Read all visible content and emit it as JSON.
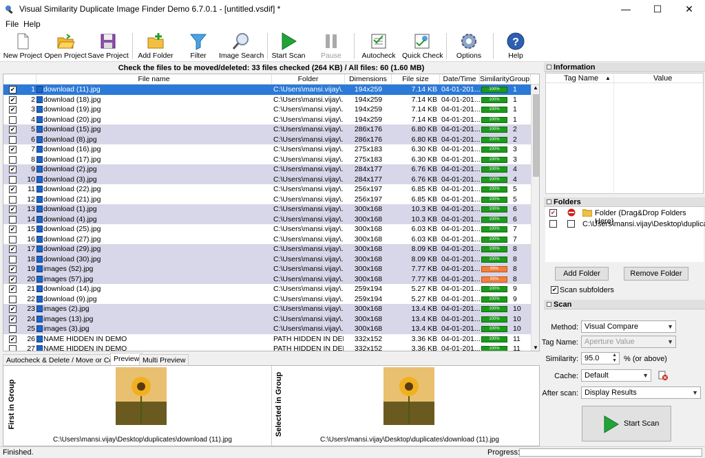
{
  "window": {
    "title": "Visual Similarity Duplicate Image Finder Demo 6.7.0.1 - [untitled.vsdif] *",
    "minimize": "—",
    "maximize": "☐",
    "close": "✕"
  },
  "menu": [
    "File",
    "Help"
  ],
  "toolbar": [
    {
      "label": "New Project",
      "icon": "new-project-icon"
    },
    {
      "label": "Open Project",
      "icon": "open-project-icon"
    },
    {
      "label": "Save Project",
      "icon": "save-project-icon"
    },
    {
      "label": "Add Folder",
      "icon": "add-folder-icon"
    },
    {
      "label": "Filter",
      "icon": "filter-icon"
    },
    {
      "label": "Image Search",
      "icon": "image-search-icon"
    },
    {
      "label": "Start Scan",
      "icon": "play-icon"
    },
    {
      "label": "Pause",
      "icon": "pause-icon"
    },
    {
      "label": "Autocheck",
      "icon": "autocheck-icon"
    },
    {
      "label": "Quick Check",
      "icon": "quick-check-icon"
    },
    {
      "label": "Options",
      "icon": "gear-icon"
    },
    {
      "label": "Help",
      "icon": "help-icon"
    }
  ],
  "results": {
    "header": "Check the files to be moved/deleted: 33 files checked (264 KB) / All files: 60 (1.60 MB)",
    "columns": [
      "File name",
      "Folder",
      "Dimensions",
      "File size",
      "Date/Time",
      "Similarity",
      "Group"
    ],
    "rows": [
      {
        "n": "1",
        "checked": true,
        "name": "download (11).jpg",
        "folder": "C:\\Users\\mansi.vijay\\...",
        "dim": "194x259",
        "size": "7.14 KB",
        "date": "04-01-201...",
        "sim": "100%",
        "group": "1"
      },
      {
        "n": "2",
        "checked": true,
        "name": "download (18).jpg",
        "folder": "C:\\Users\\mansi.vijay\\...",
        "dim": "194x259",
        "size": "7.14 KB",
        "date": "04-01-201...",
        "sim": "100%",
        "group": "1"
      },
      {
        "n": "3",
        "checked": true,
        "name": "download (19).jpg",
        "folder": "C:\\Users\\mansi.vijay\\...",
        "dim": "194x259",
        "size": "7.14 KB",
        "date": "04-01-201...",
        "sim": "100%",
        "group": "1"
      },
      {
        "n": "4",
        "checked": false,
        "name": "download (20).jpg",
        "folder": "C:\\Users\\mansi.vijay\\...",
        "dim": "194x259",
        "size": "7.14 KB",
        "date": "04-01-201...",
        "sim": "100%",
        "group": "1"
      },
      {
        "n": "5",
        "checked": true,
        "name": "download (15).jpg",
        "folder": "C:\\Users\\mansi.vijay\\...",
        "dim": "286x176",
        "size": "6.80 KB",
        "date": "04-01-201...",
        "sim": "100%",
        "group": "2"
      },
      {
        "n": "6",
        "checked": false,
        "name": "download (8).jpg",
        "folder": "C:\\Users\\mansi.vijay\\...",
        "dim": "286x176",
        "size": "6.80 KB",
        "date": "04-01-201...",
        "sim": "100%",
        "group": "2"
      },
      {
        "n": "7",
        "checked": true,
        "name": "download (16).jpg",
        "folder": "C:\\Users\\mansi.vijay\\...",
        "dim": "275x183",
        "size": "6.30 KB",
        "date": "04-01-201...",
        "sim": "100%",
        "group": "3"
      },
      {
        "n": "8",
        "checked": false,
        "name": "download (17).jpg",
        "folder": "C:\\Users\\mansi.vijay\\...",
        "dim": "275x183",
        "size": "6.30 KB",
        "date": "04-01-201...",
        "sim": "100%",
        "group": "3"
      },
      {
        "n": "9",
        "checked": true,
        "name": "download (2).jpg",
        "folder": "C:\\Users\\mansi.vijay\\...",
        "dim": "284x177",
        "size": "6.76 KB",
        "date": "04-01-201...",
        "sim": "100%",
        "group": "4"
      },
      {
        "n": "10",
        "checked": false,
        "name": "download (3).jpg",
        "folder": "C:\\Users\\mansi.vijay\\...",
        "dim": "284x177",
        "size": "6.76 KB",
        "date": "04-01-201...",
        "sim": "100%",
        "group": "4"
      },
      {
        "n": "11",
        "checked": true,
        "name": "download (22).jpg",
        "folder": "C:\\Users\\mansi.vijay\\...",
        "dim": "256x197",
        "size": "6.85 KB",
        "date": "04-01-201...",
        "sim": "100%",
        "group": "5"
      },
      {
        "n": "12",
        "checked": false,
        "name": "download (21).jpg",
        "folder": "C:\\Users\\mansi.vijay\\...",
        "dim": "256x197",
        "size": "6.85 KB",
        "date": "04-01-201...",
        "sim": "100%",
        "group": "5"
      },
      {
        "n": "13",
        "checked": true,
        "name": "download (1).jpg",
        "folder": "C:\\Users\\mansi.vijay\\...",
        "dim": "300x168",
        "size": "10.3 KB",
        "date": "04-01-201...",
        "sim": "100%",
        "group": "6"
      },
      {
        "n": "14",
        "checked": false,
        "name": "download (4).jpg",
        "folder": "C:\\Users\\mansi.vijay\\...",
        "dim": "300x168",
        "size": "10.3 KB",
        "date": "04-01-201...",
        "sim": "100%",
        "group": "6"
      },
      {
        "n": "15",
        "checked": true,
        "name": "download (25).jpg",
        "folder": "C:\\Users\\mansi.vijay\\...",
        "dim": "300x168",
        "size": "6.03 KB",
        "date": "04-01-201...",
        "sim": "100%",
        "group": "7"
      },
      {
        "n": "16",
        "checked": false,
        "name": "download (27).jpg",
        "folder": "C:\\Users\\mansi.vijay\\...",
        "dim": "300x168",
        "size": "6.03 KB",
        "date": "04-01-201...",
        "sim": "100%",
        "group": "7"
      },
      {
        "n": "17",
        "checked": true,
        "name": "download (29).jpg",
        "folder": "C:\\Users\\mansi.vijay\\...",
        "dim": "300x168",
        "size": "8.09 KB",
        "date": "04-01-201...",
        "sim": "100%",
        "group": "8"
      },
      {
        "n": "18",
        "checked": false,
        "name": "download (30).jpg",
        "folder": "C:\\Users\\mansi.vijay\\...",
        "dim": "300x168",
        "size": "8.09 KB",
        "date": "04-01-201...",
        "sim": "100%",
        "group": "8"
      },
      {
        "n": "19",
        "checked": true,
        "name": "images (52).jpg",
        "folder": "C:\\Users\\mansi.vijay\\...",
        "dim": "300x168",
        "size": "7.77 KB",
        "date": "04-01-201...",
        "sim": "99%",
        "group": "8"
      },
      {
        "n": "20",
        "checked": true,
        "name": "images (57).jpg",
        "folder": "C:\\Users\\mansi.vijay\\...",
        "dim": "300x168",
        "size": "7.77 KB",
        "date": "04-01-201...",
        "sim": "99%",
        "group": "8"
      },
      {
        "n": "21",
        "checked": true,
        "name": "download (14).jpg",
        "folder": "C:\\Users\\mansi.vijay\\...",
        "dim": "259x194",
        "size": "5.27 KB",
        "date": "04-01-201...",
        "sim": "100%",
        "group": "9"
      },
      {
        "n": "22",
        "checked": false,
        "name": "download (9).jpg",
        "folder": "C:\\Users\\mansi.vijay\\...",
        "dim": "259x194",
        "size": "5.27 KB",
        "date": "04-01-201...",
        "sim": "100%",
        "group": "9"
      },
      {
        "n": "23",
        "checked": true,
        "name": "images (2).jpg",
        "folder": "C:\\Users\\mansi.vijay\\...",
        "dim": "300x168",
        "size": "13.4 KB",
        "date": "04-01-201...",
        "sim": "100%",
        "group": "10"
      },
      {
        "n": "24",
        "checked": true,
        "name": "images (13).jpg",
        "folder": "C:\\Users\\mansi.vijay\\...",
        "dim": "300x168",
        "size": "13.4 KB",
        "date": "04-01-201...",
        "sim": "100%",
        "group": "10"
      },
      {
        "n": "25",
        "checked": false,
        "name": "images (3).jpg",
        "folder": "C:\\Users\\mansi.vijay\\...",
        "dim": "300x168",
        "size": "13.4 KB",
        "date": "04-01-201...",
        "sim": "100%",
        "group": "10"
      },
      {
        "n": "26",
        "checked": true,
        "name": "NAME HIDDEN IN DEMO",
        "folder": "PATH HIDDEN IN DEMO",
        "dim": "332x152",
        "size": "3.36 KB",
        "date": "04-01-201...",
        "sim": "100%",
        "group": "11"
      },
      {
        "n": "27",
        "checked": false,
        "name": "NAME HIDDEN IN DEMO",
        "folder": "PATH HIDDEN IN DEMO",
        "dim": "332x152",
        "size": "3.36 KB",
        "date": "04-01-201...",
        "sim": "100%",
        "group": "11"
      }
    ]
  },
  "tabs": [
    "Autocheck & Delete / Move or Copy",
    "Preview",
    "Multi Preview"
  ],
  "preview": {
    "left_label": "First in Group",
    "right_label": "Selected in Group",
    "left_path": "C:\\Users\\mansi.vijay\\Desktop\\duplicates\\download (11).jpg",
    "right_path": "C:\\Users\\mansi.vijay\\Desktop\\duplicates\\download (11).jpg"
  },
  "statusbar": {
    "left": "Finished.",
    "progress_label": "Progress:"
  },
  "information": {
    "title": "Information",
    "col_tag": "Tag Name",
    "col_value": "Value"
  },
  "folders": {
    "title": "Folders",
    "items": [
      {
        "label": "Folder (Drag&Drop Folders Here)",
        "checked": true
      },
      {
        "label": "C:\\Users\\mansi.vijay\\Desktop\\duplicates\\",
        "checked": false
      }
    ],
    "add_button": "Add Folder",
    "remove_button": "Remove Folder",
    "scan_subfolders": "Scan subfolders"
  },
  "scan": {
    "title": "Scan",
    "method_label": "Method:",
    "method_value": "Visual Compare",
    "tag_label": "Tag Name:",
    "tag_value": "Aperture Value",
    "similarity_label": "Similarity:",
    "similarity_value": "95.0",
    "similarity_suffix": "% (or above)",
    "cache_label": "Cache:",
    "cache_value": "Default",
    "after_label": "After scan:",
    "after_value": "Display Results",
    "start_button": "Start Scan"
  },
  "colors": {
    "selection": "#2b79d8",
    "alt_row": "#d7d7e9",
    "sim_green": "#1c9a1c",
    "sim_orange": "#f08040"
  }
}
